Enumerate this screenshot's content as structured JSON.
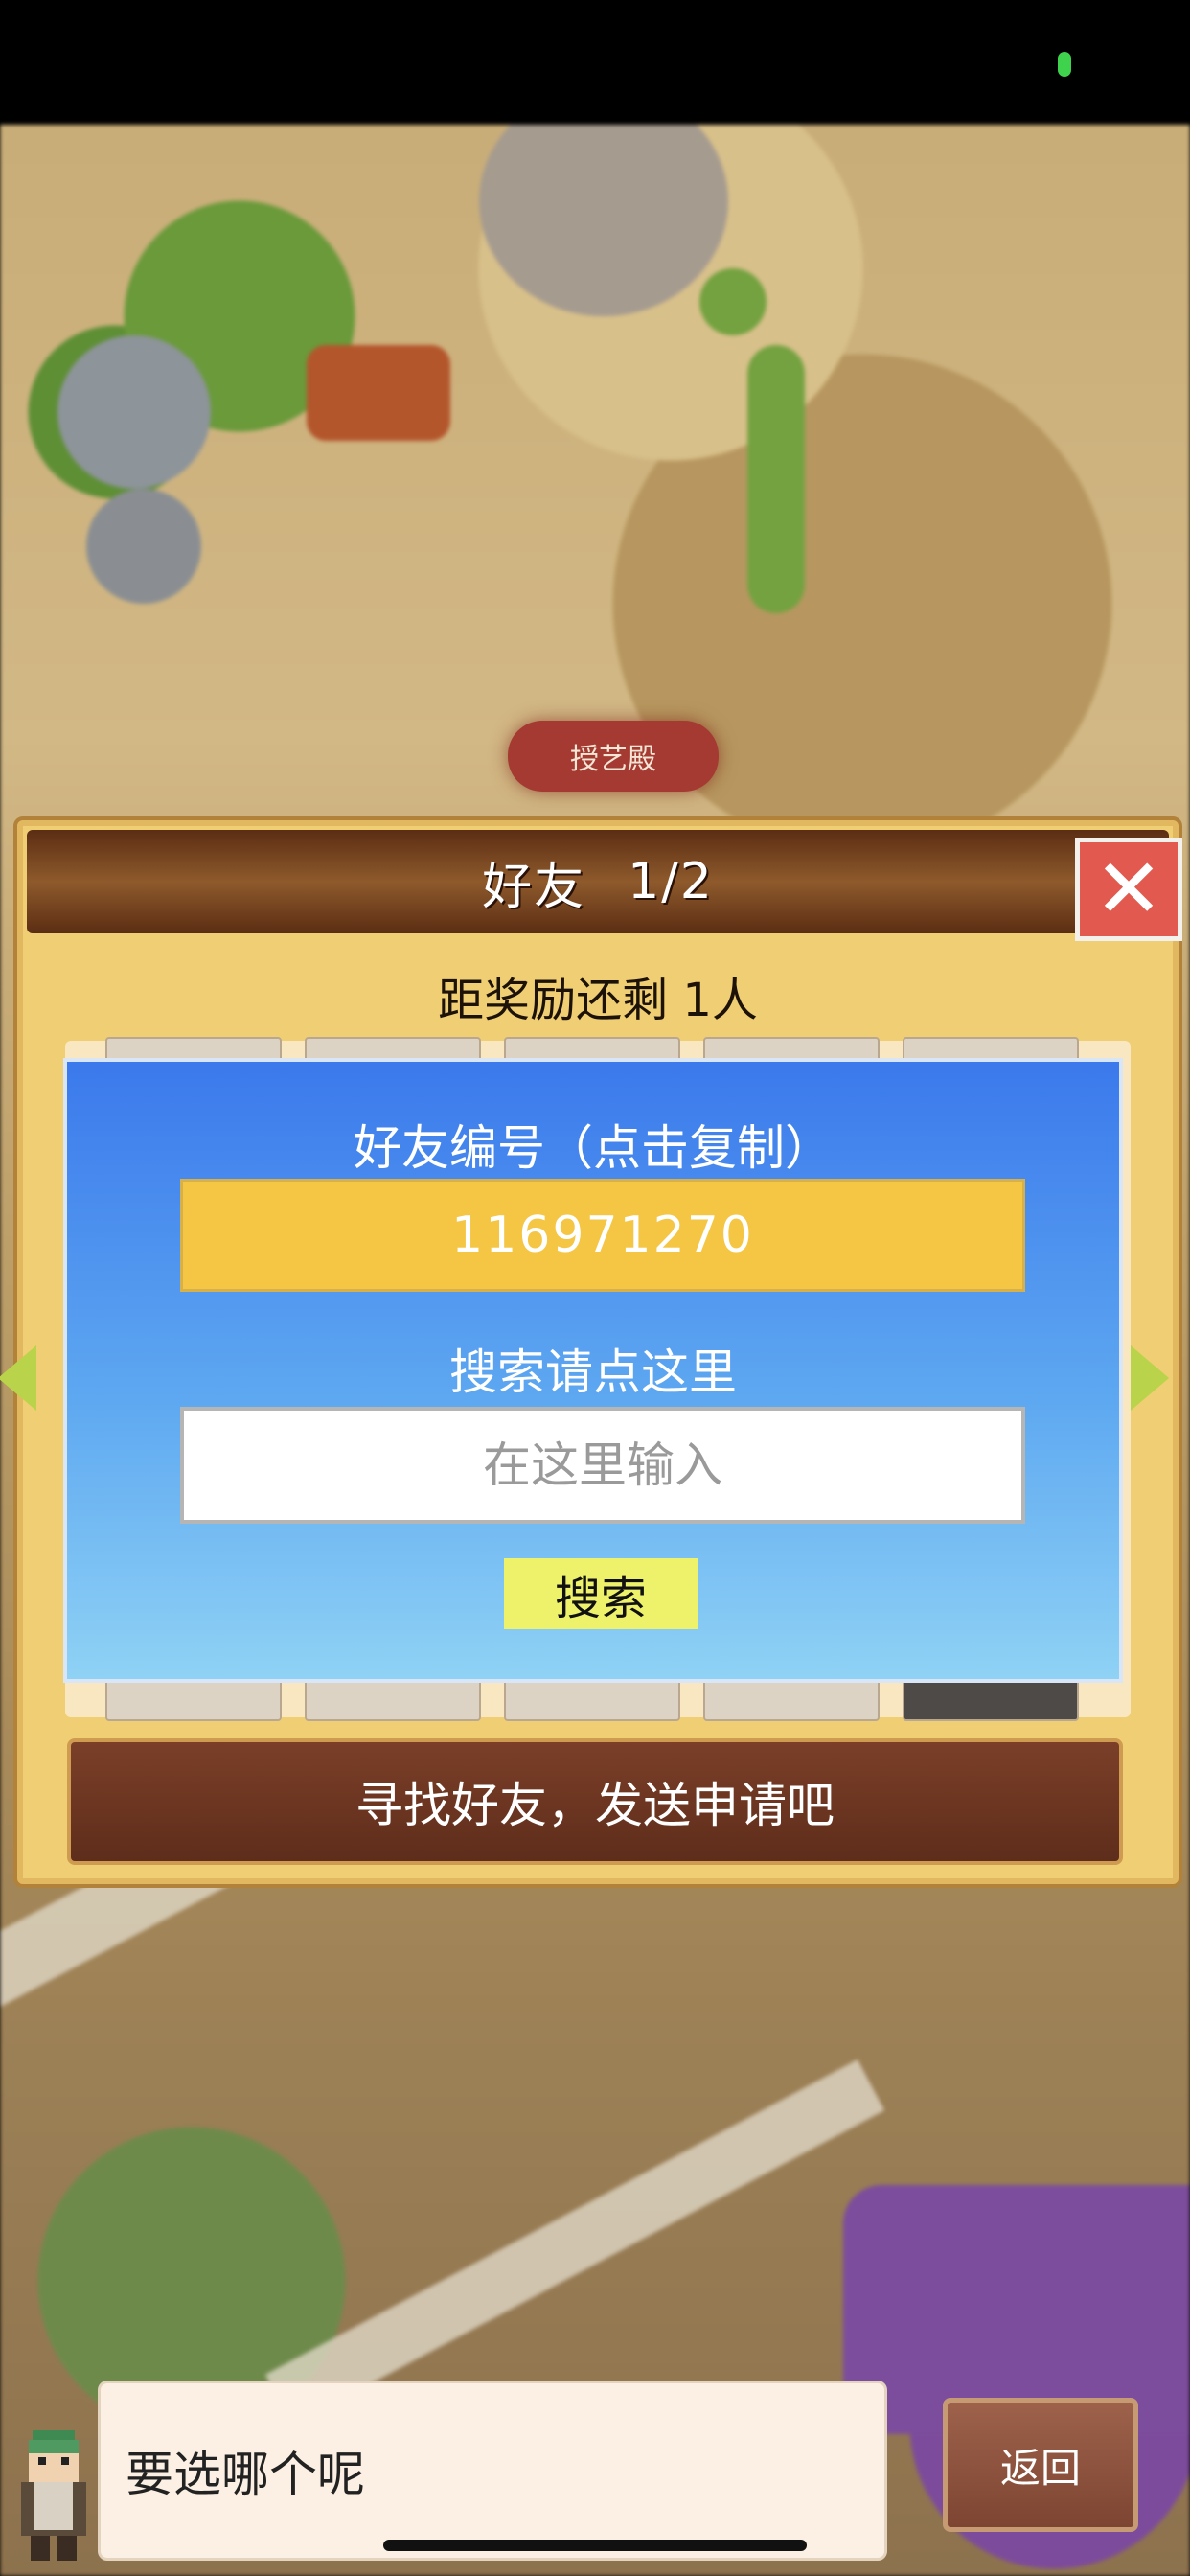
{
  "status_bar": {
    "indicator_color": "#3fd34d"
  },
  "map": {
    "building_label": "授艺殿"
  },
  "dialog": {
    "title": "好友",
    "page": "1/2",
    "reward_text": "距奖励还剩 1人",
    "close_icon": "close-x-icon",
    "find_friends_label": "寻找好友，发送申请吧"
  },
  "panel": {
    "friend_id_label": "好友编号（点击复制）",
    "friend_id_value": "116971270",
    "search_label": "搜索请点这里",
    "search_placeholder": "在这里输入",
    "search_button": "搜索"
  },
  "bottom": {
    "speech_text": "要选哪个呢",
    "back_button": "返回"
  },
  "colors": {
    "panel_top": "#3b79ec",
    "friend_id_bg": "#f4c644",
    "search_button_bg": "#eef26a",
    "close_button_bg": "#e25a4f"
  }
}
